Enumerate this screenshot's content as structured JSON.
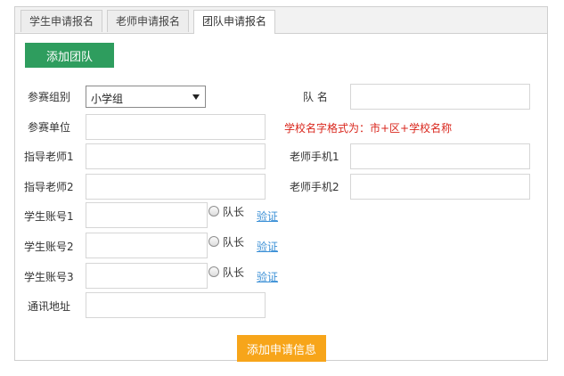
{
  "tabs": [
    {
      "label": "学生申请报名"
    },
    {
      "label": "老师申请报名"
    },
    {
      "label": "团队申请报名"
    }
  ],
  "add_team_label": "添加团队",
  "form": {
    "group": {
      "label": "参赛组别",
      "value": "小学组"
    },
    "team_name": {
      "label": "队 名",
      "value": ""
    },
    "unit": {
      "label": "参赛单位",
      "value": "",
      "hint": "学校名字格式为：市+区+学校名称"
    },
    "teacher1": {
      "label": "指导老师1",
      "value": ""
    },
    "teacher_phone1": {
      "label": "老师手机1",
      "value": ""
    },
    "teacher2": {
      "label": "指导老师2",
      "value": ""
    },
    "teacher_phone2": {
      "label": "老师手机2",
      "value": ""
    },
    "students": [
      {
        "label": "学生账号1",
        "value": "",
        "captain_label": "队长",
        "verify_label": "验证"
      },
      {
        "label": "学生账号2",
        "value": "",
        "captain_label": "队长",
        "verify_label": "验证"
      },
      {
        "label": "学生账号3",
        "value": "",
        "captain_label": "队长",
        "verify_label": "验证"
      }
    ],
    "address": {
      "label": "通讯地址",
      "value": ""
    }
  },
  "submit_label": "添加申请信息",
  "colors": {
    "green": "#2e9d5e",
    "orange": "#f7a51a",
    "hint_red": "#d9261c",
    "link_blue": "#3a8fd6"
  }
}
